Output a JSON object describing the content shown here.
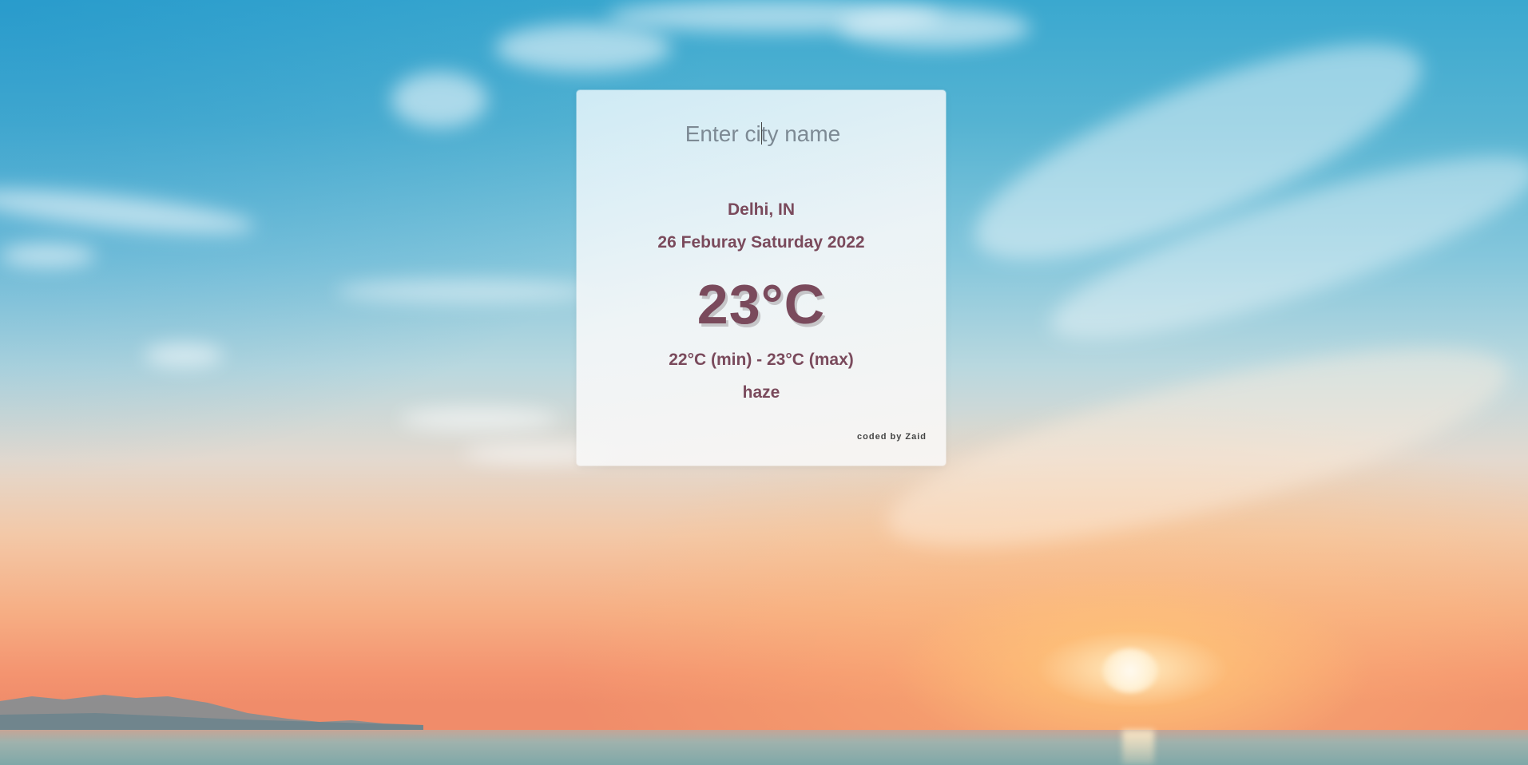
{
  "search": {
    "placeholder": "Enter city name",
    "value": ""
  },
  "weather": {
    "location": "Delhi, IN",
    "date": "26 Feburay Saturday 2022",
    "temperature": "23°C",
    "min_max": "22°C (min) - 23°C (max)",
    "condition": "haze"
  },
  "footer": {
    "credit": "coded by Zaid"
  },
  "colors": {
    "text_accent": "#7a4a5c",
    "card_background": "#f4f6f7",
    "sky_top": "#3aa8cf",
    "sunset_orange": "#f08c6a"
  }
}
